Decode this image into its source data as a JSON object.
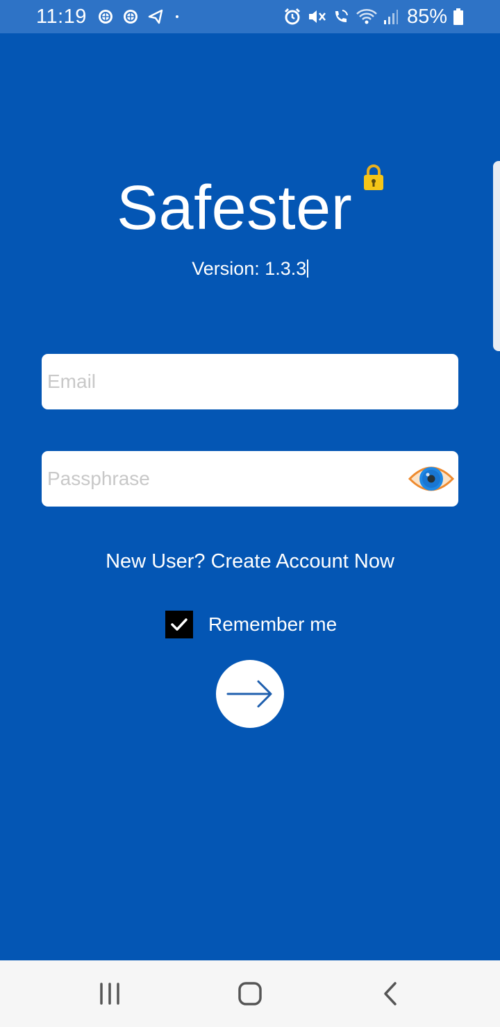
{
  "status_bar": {
    "time": "11:19",
    "battery_percent": "85%",
    "left_icons": [
      "app-notification-icon",
      "app-notification-icon",
      "send-icon",
      "dot-icon"
    ],
    "right_icons": [
      "alarm-icon",
      "mute-icon",
      "wifi-calling-icon",
      "wifi-icon",
      "signal-icon",
      "battery-icon"
    ]
  },
  "app": {
    "logo_text": "Safester",
    "version": "Version: 1.3.3"
  },
  "form": {
    "email_placeholder": "Email",
    "email_value": "",
    "passphrase_placeholder": "Passphrase",
    "passphrase_value": "",
    "create_account_link": "New User? Create Account Now",
    "remember_me_label": "Remember me",
    "remember_me_checked": true
  },
  "nav_bar": {
    "buttons": [
      "recent-apps-icon",
      "home-icon",
      "back-icon"
    ]
  },
  "colors": {
    "background": "#0456B4",
    "status_bar": "#2E73C6",
    "eye_ring": "#F0A050",
    "eye_iris": "#1E88E5",
    "lock": "#F5C518"
  }
}
